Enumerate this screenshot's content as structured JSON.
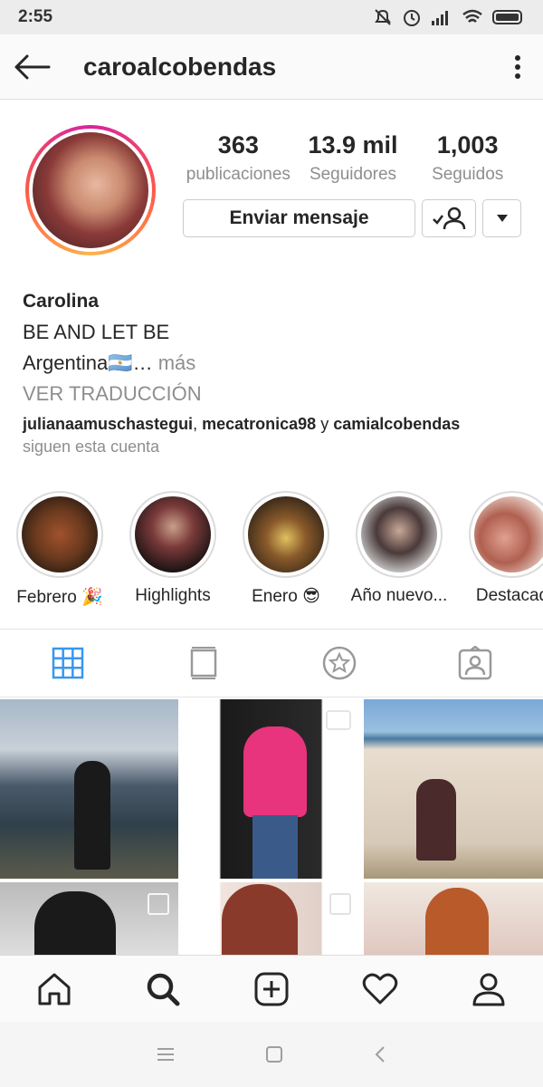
{
  "status_bar": {
    "time": "2:55"
  },
  "header": {
    "username": "caroalcobendas"
  },
  "stats": [
    {
      "value": "363",
      "label": "publicaciones"
    },
    {
      "value": "13.9 mil",
      "label": "Seguidores"
    },
    {
      "value": "1,003",
      "label": "Seguidos"
    }
  ],
  "actions": {
    "message_label": "Enviar mensaje"
  },
  "bio": {
    "name": "Carolina",
    "line1": "BE AND LET BE",
    "line2": "Argentina🇦🇷…",
    "more": "más",
    "translate": "VER TRADUCCIÓN"
  },
  "followed_by": {
    "user1": "julianaamuschastegui",
    "sep1": ",",
    "user2": "mecatronica98",
    "and": "y",
    "user3": "camialcobendas",
    "suffix": "siguen esta cuenta"
  },
  "highlights": [
    {
      "label": "Febrero 🎉"
    },
    {
      "label": "Highlights"
    },
    {
      "label": "Enero 😎"
    },
    {
      "label": "Año nuevo..."
    },
    {
      "label": "Destacad"
    }
  ],
  "colors": {
    "accent": "#3897f0",
    "text": "#262626",
    "muted": "#8e8e8e"
  }
}
